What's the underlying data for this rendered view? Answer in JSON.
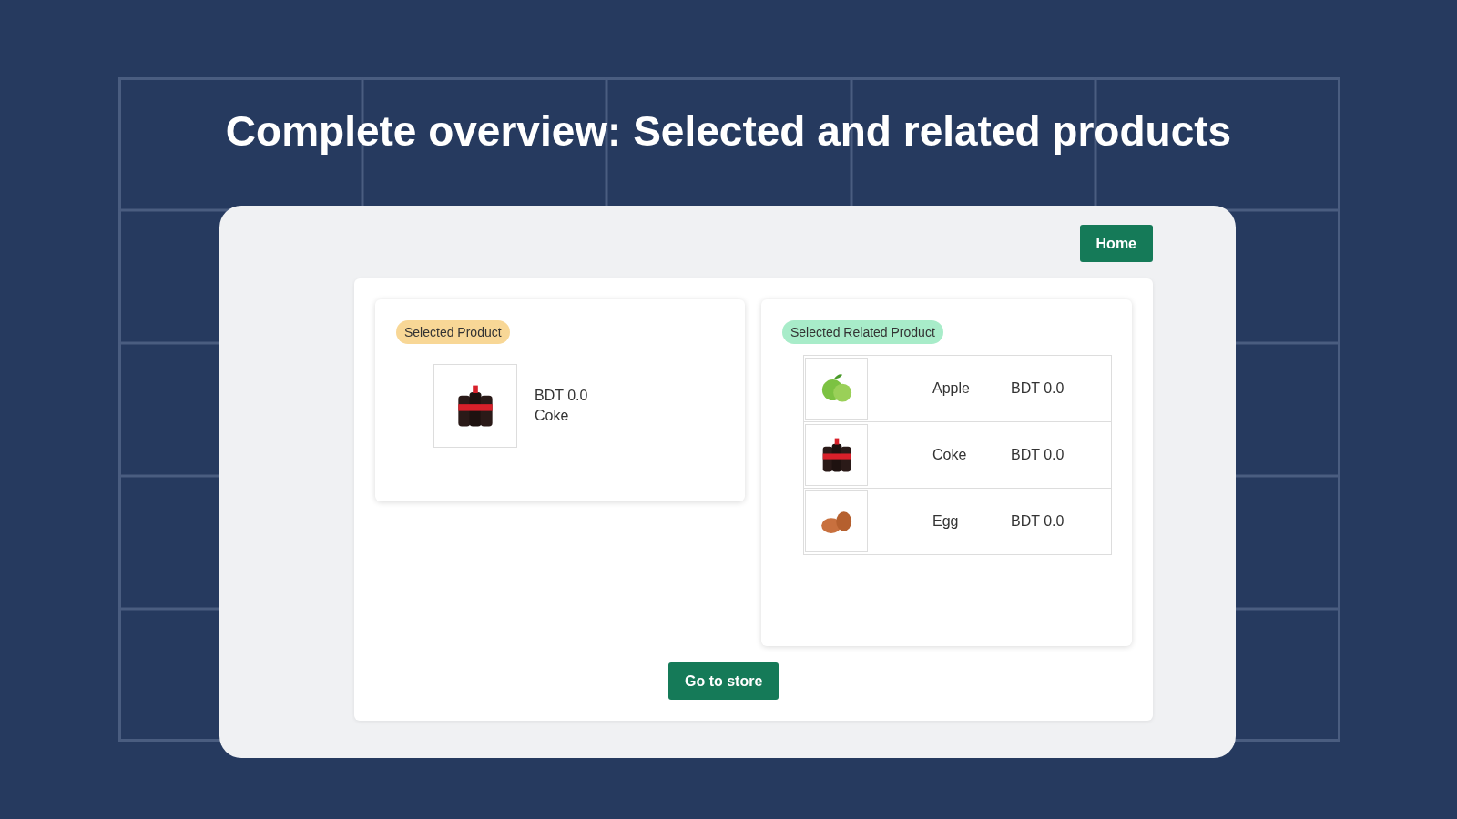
{
  "title": "Complete overview: Selected and related products",
  "home_button": "Home",
  "selected_product": {
    "badge": "Selected Product",
    "product": {
      "kind": "bottles",
      "price": "BDT 0.0",
      "name": "Coke"
    }
  },
  "related": {
    "badge": "Selected Related Product",
    "rows": [
      {
        "kind": "apple",
        "name": "Apple",
        "price": "BDT 0.0"
      },
      {
        "kind": "bottles",
        "name": "Coke",
        "price": "BDT 0.0"
      },
      {
        "kind": "egg",
        "name": "Egg",
        "price": "BDT 0.0"
      }
    ]
  },
  "store_button": "Go to store"
}
